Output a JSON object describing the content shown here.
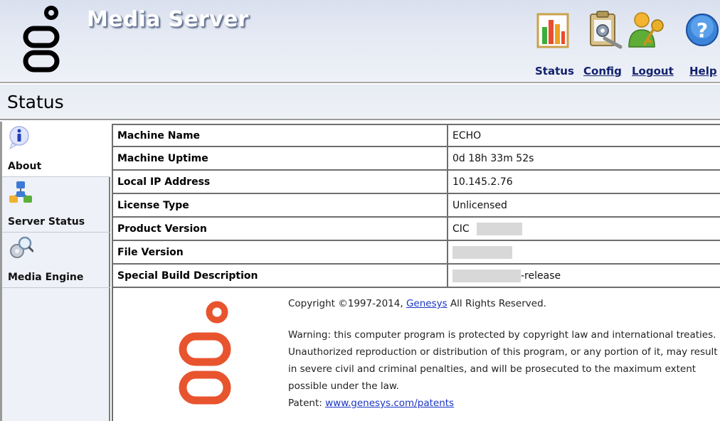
{
  "header": {
    "app_title": "Media Server",
    "nav": {
      "status": "Status",
      "config": "Config",
      "logout": "Logout",
      "help": "Help"
    }
  },
  "page_title": "Status",
  "sidebar": {
    "items": [
      {
        "label": "About",
        "icon": "info-icon",
        "active": true
      },
      {
        "label": "Server Status",
        "icon": "network-icon",
        "active": false
      },
      {
        "label": "Media Engine",
        "icon": "magnifier-gear-icon",
        "active": false
      }
    ]
  },
  "info": {
    "rows": [
      {
        "key": "Machine Name",
        "value": "ECHO"
      },
      {
        "key": "Machine Uptime",
        "value": "0d 18h 33m 52s"
      },
      {
        "key": "Local IP Address",
        "value": "10.145.2.76"
      },
      {
        "key": "License Type",
        "value": "Unlicensed"
      },
      {
        "key": "Product Version",
        "value": "CIC"
      },
      {
        "key": "File Version",
        "value": ""
      },
      {
        "key": "Special Build Description",
        "value": "-release"
      }
    ]
  },
  "footer": {
    "copyright_prefix": "Copyright ©1997-2014, ",
    "company_link": "Genesys",
    "copyright_suffix": " All Rights Reserved.",
    "warning": "Warning: this computer program is protected by copyright law and international treaties. Unauthorized reproduction or distribution of this program, or any portion of it, may result in severe civil and criminal penalties, and will be prosecuted to the maximum extent possible under the law.",
    "patent_label": "Patent: ",
    "patent_link": "www.genesys.com/patents"
  },
  "colors": {
    "brand_orange": "#e8542e",
    "nav_text": "#12216d",
    "link": "#1a35c4"
  }
}
